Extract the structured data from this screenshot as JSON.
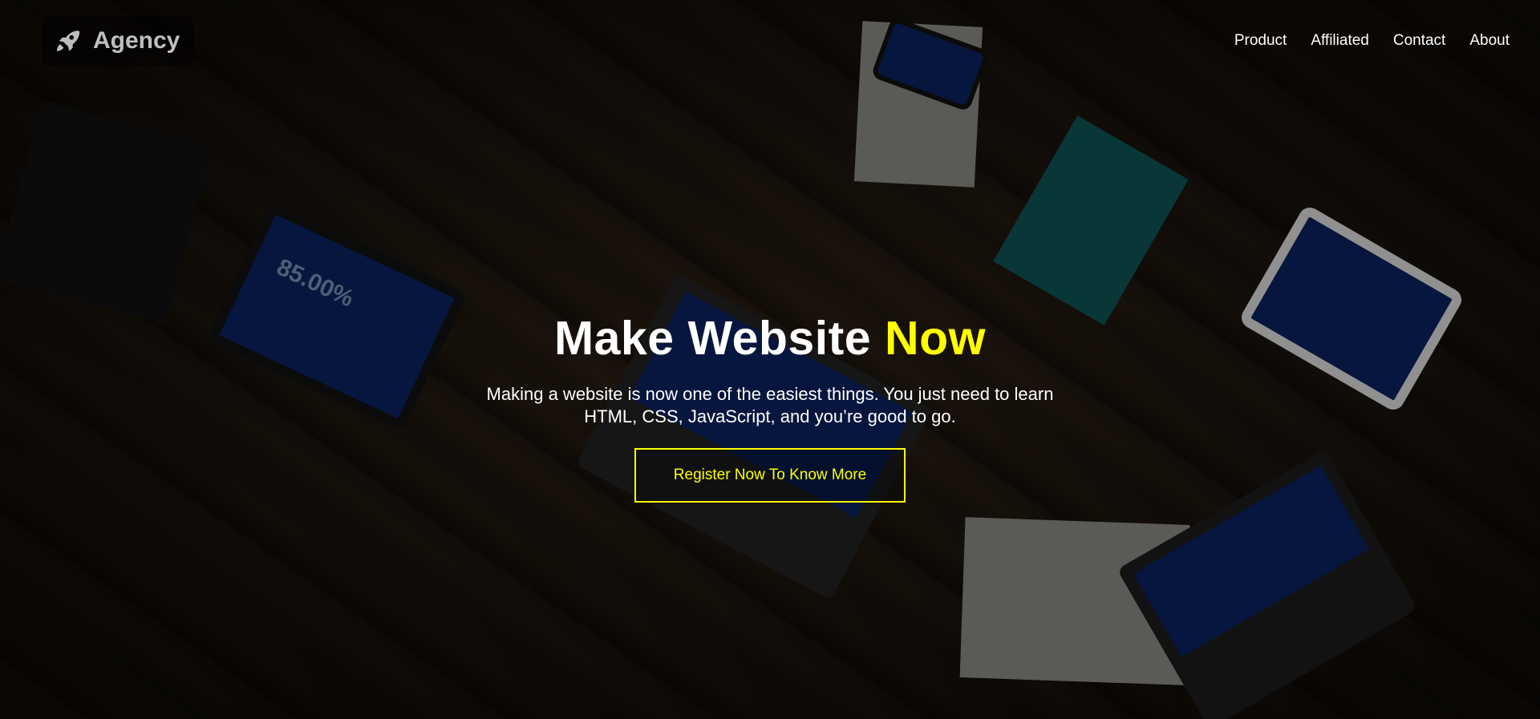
{
  "brand": {
    "icon": "rocket-icon",
    "name": "Agency"
  },
  "nav": {
    "items": [
      {
        "label": "Product"
      },
      {
        "label": "Affiliated"
      },
      {
        "label": "Contact"
      },
      {
        "label": "About"
      }
    ]
  },
  "hero": {
    "title_main": "Make Website ",
    "title_accent": "Now",
    "description": "Making a website is now one of the easiest things. You just need to learn HTML, CSS, JavaScript, and you’re good to go.",
    "cta_label": "Register Now To Know More",
    "tablet_stat": "85.00%"
  },
  "colors": {
    "accent": "#ffff00",
    "text": "#ffffff"
  }
}
